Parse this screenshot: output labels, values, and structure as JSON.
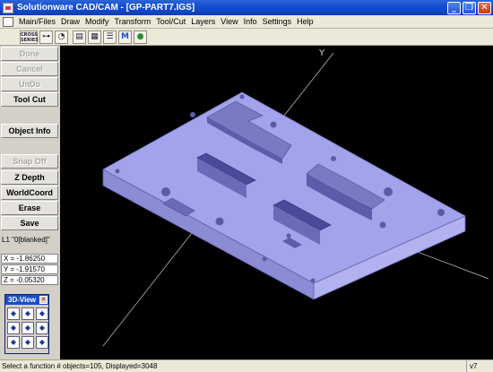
{
  "window": {
    "title": "Solutionware CAD/CAM - [GP-PART7.IGS]",
    "minimize": "_",
    "restore": "❐",
    "close": "✕"
  },
  "menu": {
    "items": [
      "Main/Files",
      "Draw",
      "Modify",
      "Transform",
      "Tool/Cut",
      "Layers",
      "View",
      "Info",
      "Settings",
      "Help"
    ]
  },
  "toolbar": {
    "buttons": [
      {
        "icon": "info-card-icon",
        "label": "CROSS SERIES"
      },
      {
        "icon": "line-tool-icon",
        "label": "⊶"
      },
      {
        "icon": "clock-icon",
        "label": "◔"
      },
      {
        "icon": "document-icon",
        "label": "▤"
      },
      {
        "icon": "print-icon",
        "label": "▦"
      },
      {
        "icon": "list-icon",
        "label": "☰"
      },
      {
        "icon": "machine-icon",
        "label": "M"
      },
      {
        "icon": "globe-icon",
        "label": "●"
      }
    ]
  },
  "left_panel": {
    "buttons": {
      "done": "Done",
      "cancel": "Cancel",
      "undo": "UnDo",
      "tool_cut": "Tool Cut",
      "object_info": "Object Info",
      "snap_off": "Snap Off",
      "z_depth": "Z Depth",
      "world_coord": "WorldCoord",
      "erase": "Erase",
      "save": "Save"
    },
    "layer": "L1  \"0[blanked]\"",
    "coords": {
      "x": "X = -1.86250",
      "y": "Y = -1.91570",
      "z": "Z = -0.05320"
    }
  },
  "palette": {
    "title": "3D-View",
    "close": "×",
    "buttons": [
      "◆",
      "◆",
      "◆",
      "◆",
      "◆",
      "◆",
      "◆",
      "◆",
      "◆"
    ]
  },
  "viewport": {
    "axis_y_label": "Y",
    "background": "#000000",
    "part_color": "#9e9ee8"
  },
  "status": {
    "message": "Select a function    # objects=105, Displayed=3048",
    "version": "v7"
  }
}
